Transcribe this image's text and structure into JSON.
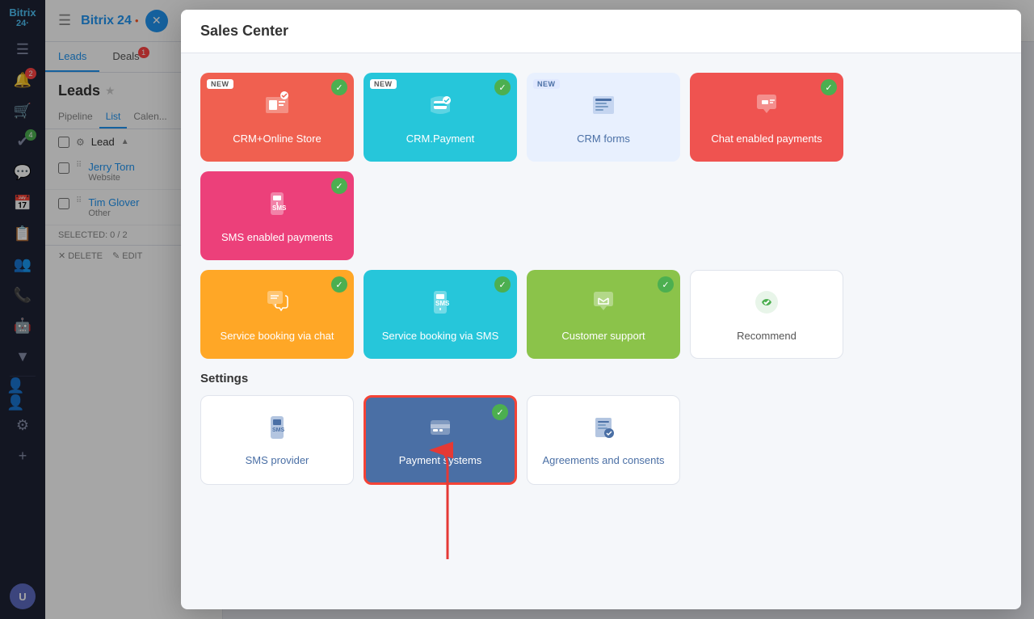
{
  "app": {
    "name": "Bitrix 24",
    "logo": "Bitrix 24·"
  },
  "sidebar": {
    "icons": [
      "☰",
      "🛒",
      "📋",
      "📅",
      "💬",
      "👥",
      "📊",
      "⚙",
      "+"
    ],
    "badges": [
      {
        "index": 0,
        "count": "2",
        "color": "red"
      },
      {
        "index": 3,
        "count": "4",
        "color": "red"
      }
    ]
  },
  "crm": {
    "tabs": [
      {
        "label": "Leads",
        "active": true,
        "badge": null
      },
      {
        "label": "Deals",
        "active": false,
        "badge": {
          "count": "1",
          "color": "red"
        }
      }
    ],
    "title": "Leads",
    "subtabs": [
      {
        "label": "Pipeline",
        "active": false
      },
      {
        "label": "List",
        "active": true
      },
      {
        "label": "Calen...",
        "active": false
      }
    ],
    "list_header": {
      "col": "Lead"
    },
    "rows": [
      {
        "name": "Jerry Torn",
        "sub": "Website"
      },
      {
        "name": "Tim Glover",
        "sub": "Other"
      }
    ],
    "selected_text": "SELECTED: 0 / 2",
    "actions": [
      {
        "icon": "✕",
        "label": "DELETE"
      },
      {
        "icon": "✎",
        "label": "EDIT"
      }
    ]
  },
  "modal": {
    "title": "Sales Center",
    "cards": [
      {
        "id": "crm-online-store",
        "label": "CRM+Online Store",
        "color": "red",
        "badge_new": true,
        "checked": true,
        "icon": "🛍"
      },
      {
        "id": "crm-payment",
        "label": "CRM.Payment",
        "color": "teal",
        "badge_new": true,
        "checked": true,
        "icon": "🧺"
      },
      {
        "id": "crm-forms",
        "label": "CRM forms",
        "color": "blue-light",
        "badge_new": true,
        "checked": false,
        "icon": "🖥"
      },
      {
        "id": "chat-enabled-payments",
        "label": "Chat enabled payments",
        "color": "salmon",
        "badge_new": false,
        "checked": true,
        "icon": "💬"
      },
      {
        "id": "sms-enabled-payments",
        "label": "SMS enabled payments",
        "color": "pink",
        "badge_new": false,
        "checked": true,
        "icon": "📱"
      },
      {
        "id": "service-booking-chat",
        "label": "Service booking via chat",
        "color": "orange",
        "badge_new": false,
        "checked": true,
        "icon": "💬"
      },
      {
        "id": "service-booking-sms",
        "label": "Service booking via SMS",
        "color": "teal2",
        "badge_new": false,
        "checked": true,
        "icon": "📲"
      },
      {
        "id": "customer-support",
        "label": "Customer support",
        "color": "green",
        "badge_new": false,
        "checked": true,
        "icon": "💬"
      },
      {
        "id": "recommend",
        "label": "Recommend",
        "color": "white",
        "badge_new": false,
        "checked": false,
        "icon": "👍"
      }
    ],
    "settings_title": "Settings",
    "settings_cards": [
      {
        "id": "sms-provider",
        "label": "SMS provider",
        "selected": false,
        "icon": "📱"
      },
      {
        "id": "payment-systems",
        "label": "Payment systems",
        "selected": true,
        "icon": "💳"
      },
      {
        "id": "agreements-consents",
        "label": "Agreements and consents",
        "selected": false,
        "icon": "📋"
      }
    ]
  }
}
